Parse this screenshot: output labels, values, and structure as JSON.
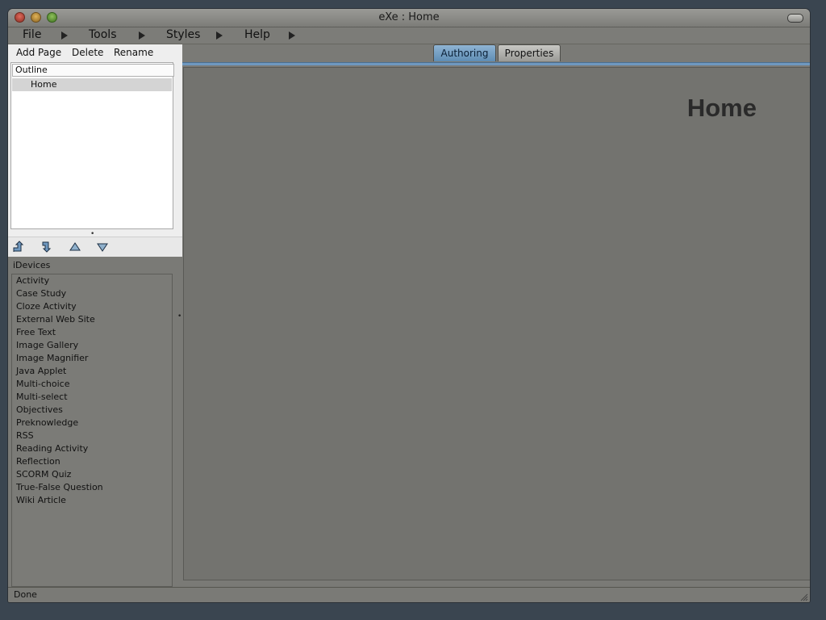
{
  "window": {
    "title": "eXe : Home"
  },
  "menu": {
    "items": [
      "File",
      "Tools",
      "Styles",
      "Help"
    ]
  },
  "outline_toolbar": {
    "add_page": "Add Page",
    "delete": "Delete",
    "rename": "Rename"
  },
  "outline": {
    "header": "Outline",
    "items": [
      "Home"
    ],
    "selected": "Home"
  },
  "idevices": {
    "label": "iDevices",
    "items": [
      "Activity",
      "Case Study",
      "Cloze Activity",
      "External Web Site",
      "Free Text",
      "Image Gallery",
      "Image Magnifier",
      "Java Applet",
      "Multi-choice",
      "Multi-select",
      "Objectives",
      "Preknowledge",
      "RSS",
      "Reading Activity",
      "Reflection",
      "SCORM Quiz",
      "True-False Question",
      "Wiki Article"
    ]
  },
  "tabs": {
    "authoring": "Authoring",
    "properties": "Properties",
    "active": "Authoring"
  },
  "content": {
    "heading": "Home"
  },
  "status": {
    "text": "Done"
  },
  "colors": {
    "active_tab": "#6f98bf",
    "window_bg": "#7a7a76",
    "panel_bg": "#eeeeee"
  }
}
